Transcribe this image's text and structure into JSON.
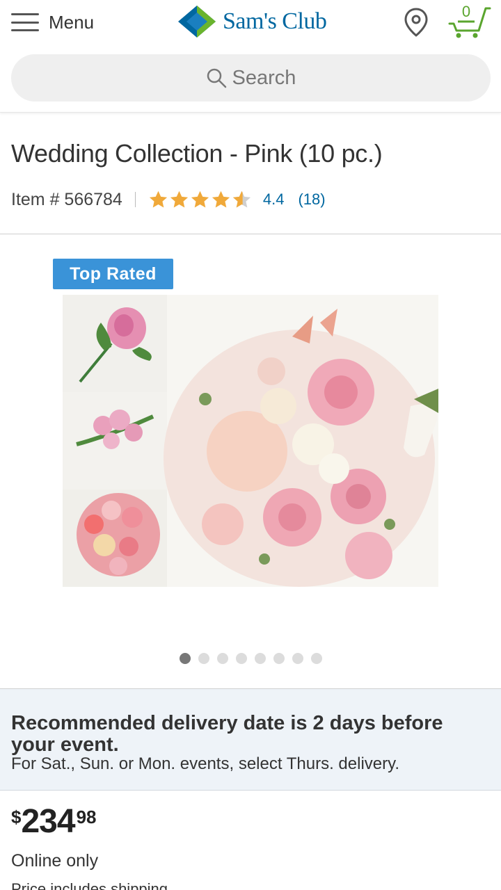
{
  "header": {
    "menu_label": "Menu",
    "logo_text": "Sam's Club",
    "cart_count": "0",
    "search_placeholder": "Search"
  },
  "product": {
    "title": "Wedding Collection - Pink (10 pc.)",
    "item_number": "Item # 566784",
    "rating_value": 4.4,
    "rating_text": "4.4",
    "review_count": "(18)",
    "badge": "Top Rated"
  },
  "gallery": {
    "total_images": 8,
    "active_index": 0
  },
  "delivery_notice": {
    "headline": "Recommended delivery date is 2 days before your event.",
    "subtext": "For Sat., Sun. or Mon. events, select Thurs. delivery."
  },
  "pricing": {
    "currency_symbol": "$",
    "dollars": "234",
    "cents": "98",
    "availability": "Online only",
    "shipping_note": "Price includes shipping"
  },
  "colors": {
    "brand_blue": "#0067a0",
    "logo_green": "#6ab42d",
    "cart_green": "#5aa52e",
    "star_gold": "#f0a93a",
    "badge_blue": "#3a93d8",
    "notice_bg": "#eef3f8"
  },
  "icons": {
    "menu": "hamburger-icon",
    "location": "location-pin-icon",
    "cart": "cart-icon",
    "search": "search-icon",
    "rating": "star-icon"
  }
}
